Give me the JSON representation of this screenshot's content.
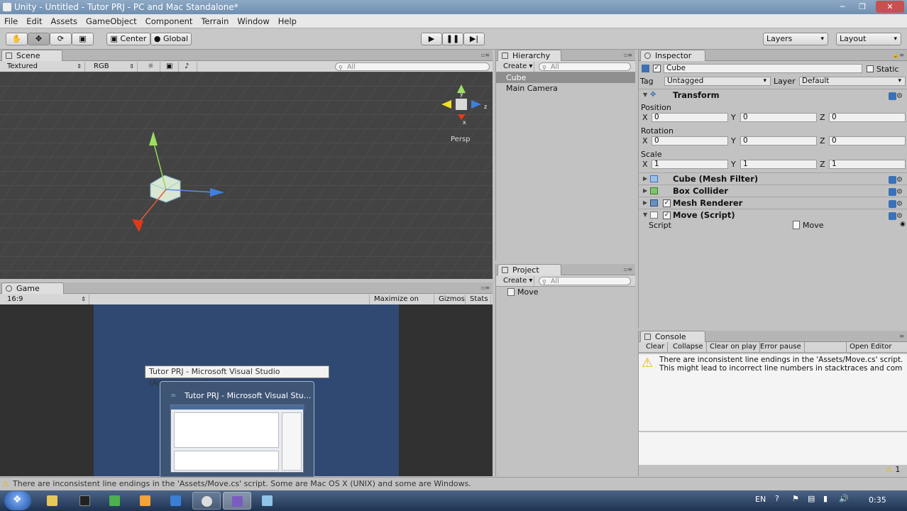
{
  "window": {
    "title": "Unity - Untitled - Tutor PRJ - PC and Mac Standalone*"
  },
  "menu": [
    "File",
    "Edit",
    "Assets",
    "GameObject",
    "Component",
    "Terrain",
    "Window",
    "Help"
  ],
  "toolbar": {
    "pivot": "Center",
    "space": "Global",
    "layers": "Layers",
    "layout": "Layout"
  },
  "scene": {
    "tab": "Scene",
    "render_mode": "Textured",
    "color_mode": "RGB",
    "search_placeholder": "All",
    "persp_label": "Persp"
  },
  "game": {
    "tab": "Game",
    "aspect": "16:9",
    "maximize": "Maximize on Play",
    "gizmos": "Gizmos",
    "stats": "Stats"
  },
  "hierarchy": {
    "tab": "Hierarchy",
    "create": "Create",
    "search_placeholder": "All",
    "items": [
      "Cube",
      "Main Camera"
    ]
  },
  "project": {
    "tab": "Project",
    "create": "Create",
    "search_placeholder": "All",
    "items": [
      "Move"
    ]
  },
  "inspector": {
    "tab": "Inspector",
    "object_name": "Cube",
    "static_label": "Static",
    "tag_label": "Tag",
    "tag_value": "Untagged",
    "layer_label": "Layer",
    "layer_value": "Default",
    "transform": {
      "title": "Transform",
      "position_label": "Position",
      "rotation_label": "Rotation",
      "scale_label": "Scale",
      "axis_x": "X",
      "axis_y": "Y",
      "axis_z": "Z",
      "position": [
        "0",
        "0",
        "0"
      ],
      "rotation": [
        "0",
        "0",
        "0"
      ],
      "scale": [
        "1",
        "1",
        "1"
      ]
    },
    "components": [
      "Cube (Mesh Filter)",
      "Box Collider",
      "Mesh Renderer",
      "Move (Script)"
    ],
    "script_label": "Script",
    "script_value": "Move"
  },
  "console": {
    "tab": "Console",
    "buttons": [
      "Clear",
      "Collapse",
      "Clear on play",
      "Error pause",
      "Open Editor Log"
    ],
    "message_line1": "There are inconsistent line endings in the 'Assets/Move.cs' script.",
    "message_line2": "This might lead to incorrect line numbers in stacktraces and com",
    "warning_count": "1"
  },
  "tooltip": {
    "label": "Tutor PRJ - Microsoft Visual Studio (Administrator)",
    "thumb_title": "Tutor PRJ - Microsoft Visual Stu..."
  },
  "status": {
    "message": "There are inconsistent line endings in the 'Assets/Move.cs' script. Some are Mac OS X (UNIX) and some are Windows."
  },
  "taskbar": {
    "language": "EN",
    "clock": "0:35"
  }
}
